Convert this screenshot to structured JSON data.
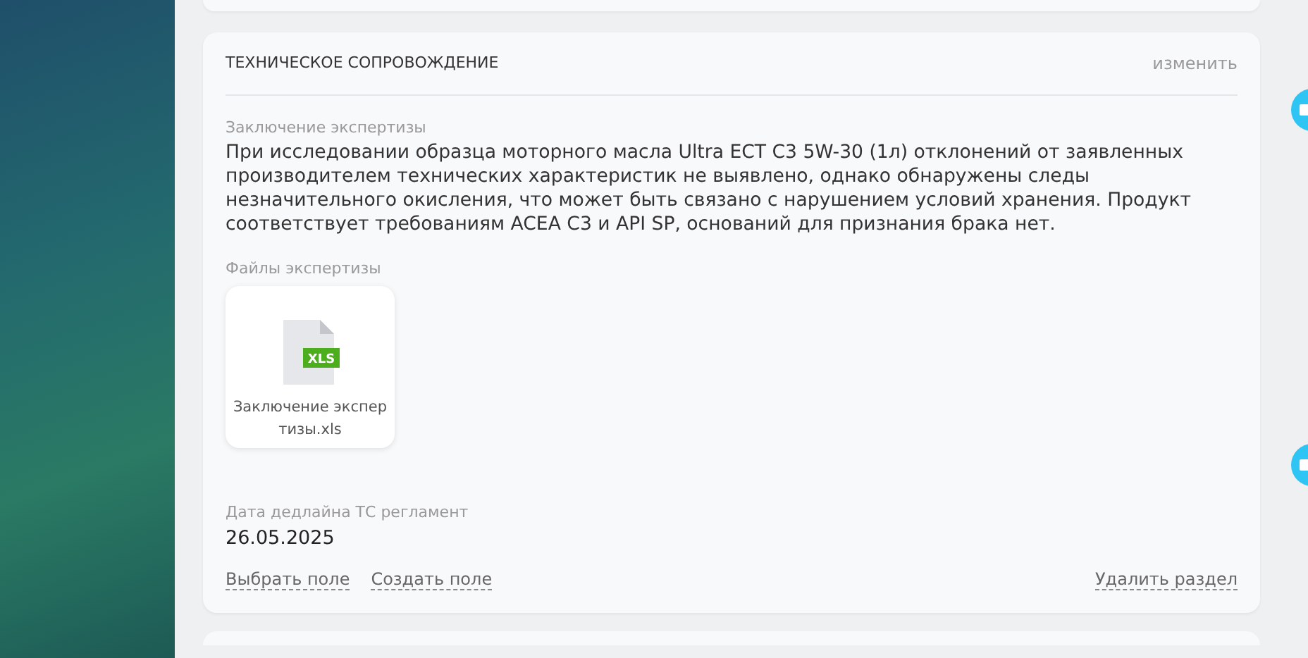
{
  "section": {
    "title": "ТЕХНИЧЕСКОЕ СОПРОВОЖДЕНИЕ",
    "edit_link": "изменить",
    "conclusion": {
      "label": "Заключение экспертизы",
      "text": "При исследовании образца моторного масла Ultra ECT C3 5W-30 (1л) отклонений от заявленных производителем технических характеристик не выявлено, однако обнаружены следы незначительного окисления, что может быть связано с нарушением условий хранения. Продукт соответствует требованиям ACEA C3 и API SP, оснований для признания брака нет."
    },
    "files": {
      "label": "Файлы экспертизы",
      "items": [
        {
          "badge": "XLS",
          "name": "Заключение экспер тизы.xls"
        }
      ]
    },
    "deadline": {
      "label": "Дата дедлайна ТС регламент",
      "value": "26.05.2025"
    },
    "actions": [
      "Выбрать поле",
      "Создать поле"
    ],
    "delete_link": "Удалить раздел"
  }
}
